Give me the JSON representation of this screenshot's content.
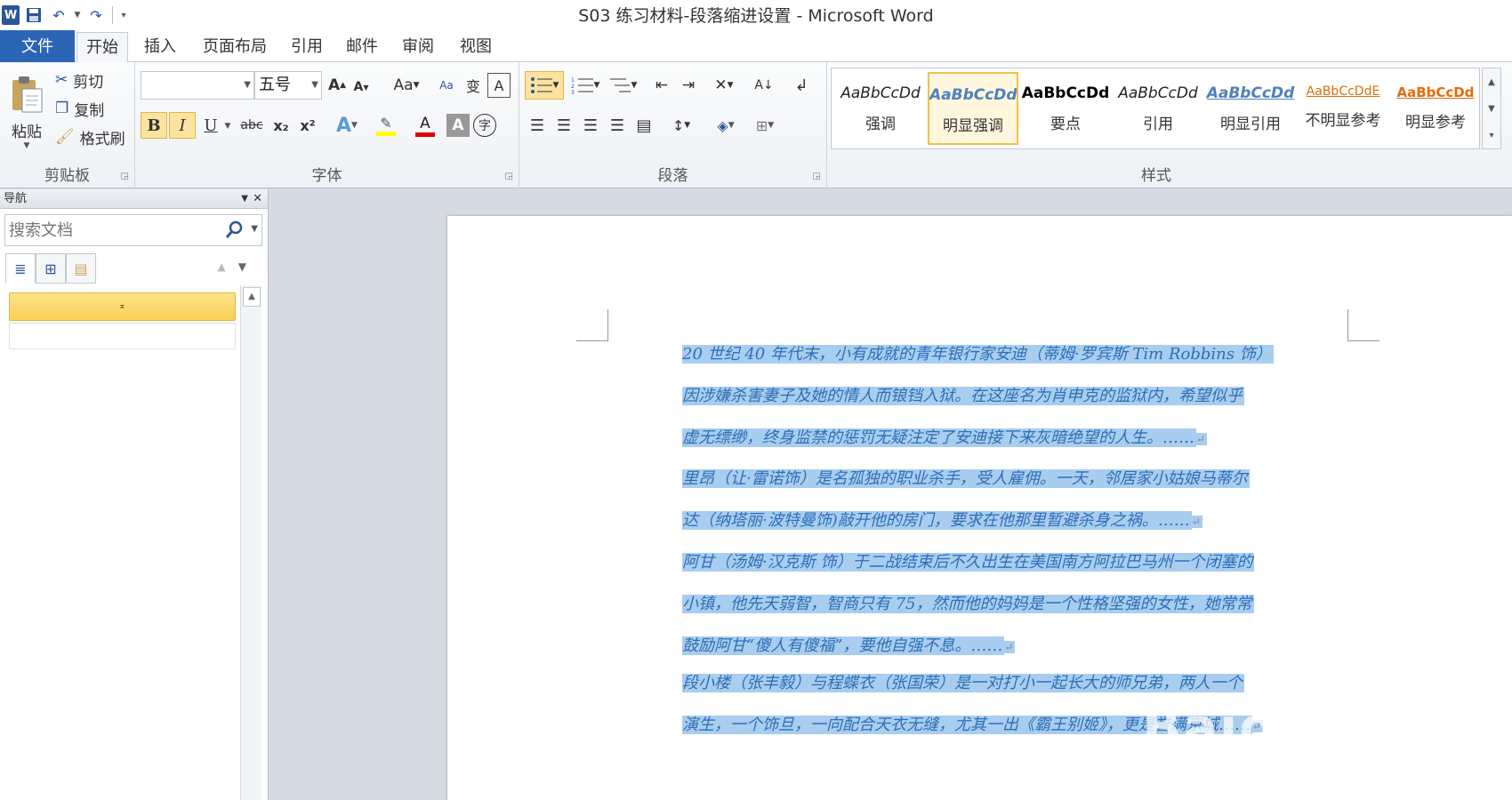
{
  "window": {
    "title": "S03 练习材料-段落缩进设置 - Microsoft Word",
    "app_letter": "W"
  },
  "tabs": [
    "文件",
    "开始",
    "插入",
    "页面布局",
    "引用",
    "邮件",
    "审阅",
    "视图"
  ],
  "clipboard": {
    "paste": "粘贴",
    "cut": "剪切",
    "copy": "复制",
    "format_painter": "格式刷",
    "label": "剪贴板"
  },
  "font": {
    "name": "",
    "size": "五号",
    "label": "字体",
    "bold": "B",
    "italic": "I",
    "underline": "U",
    "strike": "abc",
    "subscript": "x₂",
    "superscript": "x²"
  },
  "paragraph": {
    "label": "段落"
  },
  "styles": {
    "label": "样式",
    "items": [
      {
        "sample": "AaBbCcDd",
        "name": "强调",
        "color": "#222222"
      },
      {
        "sample": "AaBbCcDd",
        "name": "明显强调",
        "color": "#4f81bd"
      },
      {
        "sample": "AaBbCcDd",
        "name": "要点",
        "color": "#000000"
      },
      {
        "sample": "AaBbCcDd",
        "name": "引用",
        "color": "#222222"
      },
      {
        "sample": "AaBbCcDd",
        "name": "明显引用",
        "color": "#4f81bd"
      },
      {
        "sample": "AaBbCcDdE",
        "name": "不明显参考",
        "color": "#e36c0a"
      },
      {
        "sample": "AaBbCcDd",
        "name": "明显参考",
        "color": "#e36c0a"
      }
    ],
    "selected": "明显强调"
  },
  "nav": {
    "title": "导航",
    "search_placeholder": "搜索文档",
    "heading_marker": "⌅"
  },
  "document": {
    "paragraphs": [
      [
        "20 世纪 40 年代末，小有成就的青年银行家安迪（蒂姆·罗宾斯 Tim Robbins 饰）",
        "因涉嫌杀害妻子及她的情人而锒铛入狱。在这座名为肖申克的监狱内，希望似乎",
        "虚无缥缈，终身监禁的惩罚无疑注定了安迪接下来灰暗绝望的人生。……"
      ],
      [
        "里昂（让·雷诺饰）是名孤独的职业杀手，受人雇佣。一天，邻居家小姑娘马蒂尔",
        "达（纳塔丽·波特曼饰)敲开他的房门，要求在他那里暂避杀身之祸。……"
      ],
      [
        "阿甘（汤姆·汉克斯 饰）于二战结束后不久出生在美国南方阿拉巴马州一个闭塞的",
        "小镇，他先天弱智，智商只有 75，然而他的妈妈是一个性格坚强的女性，她常常",
        "鼓励阿甘“傻人有傻福”，要他自强不息。……"
      ],
      [
        "段小楼（张丰毅）与程蝶衣（张国荣）是一对打小一起长大的师兄弟，两人一个",
        "演生，一个饰旦，一向配合天衣无缝，尤其一出《霸王别姬》，更是誉满京城……"
      ]
    ]
  },
  "watermark": {
    "brand": "Baidu经验",
    "url": "jingyan.baidu.com"
  }
}
